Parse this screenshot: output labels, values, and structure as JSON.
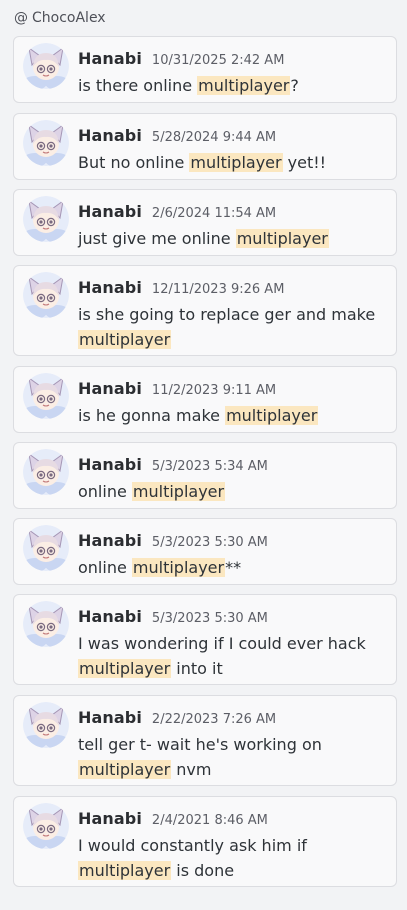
{
  "channel": {
    "prefix": "@",
    "name": "ChocoAlex"
  },
  "highlight_color": "#fbe7c0",
  "results": [
    {
      "author": "Hanabi",
      "timestamp": "10/31/2025 2:42 AM",
      "parts": [
        {
          "t": "is there online "
        },
        {
          "t": "multiplayer",
          "h": true
        },
        {
          "t": "?"
        }
      ]
    },
    {
      "author": "Hanabi",
      "timestamp": "5/28/2024 9:44 AM",
      "parts": [
        {
          "t": "But no online "
        },
        {
          "t": "multiplayer",
          "h": true
        },
        {
          "t": " yet!!"
        }
      ]
    },
    {
      "author": "Hanabi",
      "timestamp": "2/6/2024 11:54 AM",
      "parts": [
        {
          "t": "just give me online "
        },
        {
          "t": "multiplayer",
          "h": true
        }
      ]
    },
    {
      "author": "Hanabi",
      "timestamp": "12/11/2023 9:26 AM",
      "parts": [
        {
          "t": "is she going to replace ger and make "
        },
        {
          "t": "multiplayer",
          "h": true
        }
      ]
    },
    {
      "author": "Hanabi",
      "timestamp": "11/2/2023 9:11 AM",
      "parts": [
        {
          "t": "is he gonna make "
        },
        {
          "t": "multiplayer",
          "h": true
        }
      ]
    },
    {
      "author": "Hanabi",
      "timestamp": "5/3/2023 5:34 AM",
      "parts": [
        {
          "t": "online "
        },
        {
          "t": "multiplayer",
          "h": true
        }
      ]
    },
    {
      "author": "Hanabi",
      "timestamp": "5/3/2023 5:30 AM",
      "parts": [
        {
          "t": "online "
        },
        {
          "t": "multiplayer",
          "h": true
        },
        {
          "t": "**"
        }
      ]
    },
    {
      "author": "Hanabi",
      "timestamp": "5/3/2023 5:30 AM",
      "parts": [
        {
          "t": "I was wondering if I could ever hack "
        },
        {
          "t": "multiplayer",
          "h": true
        },
        {
          "t": " into it"
        }
      ]
    },
    {
      "author": "Hanabi",
      "timestamp": "2/22/2023 7:26 AM",
      "parts": [
        {
          "t": "tell ger t- wait he's working on "
        },
        {
          "t": "multiplayer",
          "h": true
        },
        {
          "t": " nvm"
        }
      ]
    },
    {
      "author": "Hanabi",
      "timestamp": "2/4/2021 8:46 AM",
      "parts": [
        {
          "t": "I would constantly ask him if "
        },
        {
          "t": "multiplayer",
          "h": true
        },
        {
          "t": " is done"
        }
      ]
    }
  ]
}
